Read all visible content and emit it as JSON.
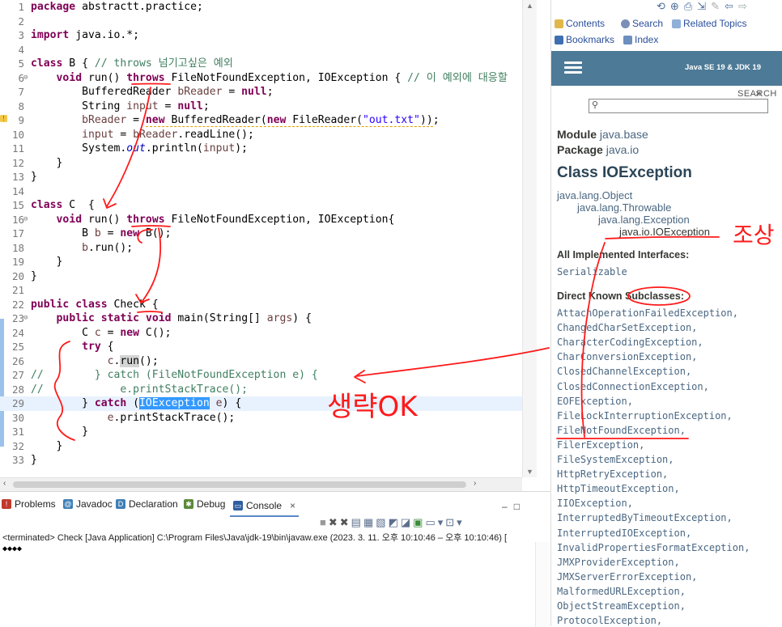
{
  "editor": {
    "lines": [
      {
        "n": "1",
        "marker": "",
        "html": "<span class=\"kw\">package</span> abstractt.practice;"
      },
      {
        "n": "2",
        "marker": "",
        "html": ""
      },
      {
        "n": "3",
        "marker": "",
        "html": "<span class=\"kw\">import</span> java.io.*;"
      },
      {
        "n": "4",
        "marker": "",
        "html": ""
      },
      {
        "n": "5",
        "marker": "",
        "html": "<span class=\"kw\">class</span> B { <span class=\"cm\">// throws 넘기고싶은 예외</span>"
      },
      {
        "n": "6",
        "marker": "⊖",
        "html": "    <span class=\"kw\">void</span> run() <span class=\"kw\">throws</span> FileNotFoundException, IOException { <span class=\"cm\">// 이 예외에 대응할</span>"
      },
      {
        "n": "7",
        "marker": "",
        "html": "        BufferedReader <span class=\"varu\">bReader</span> = <span class=\"kw\">null</span>;"
      },
      {
        "n": "8",
        "marker": "",
        "html": "        String <span class=\"varu\">input</span> = <span class=\"kw\">null</span>;"
      },
      {
        "n": "9",
        "marker": "",
        "html": "        <span class=\"varu\">bReader</span> = <span class=\"uline\"><span class=\"kw\">new</span> BufferedReader(<span class=\"kw\">new</span> FileReader(<span class=\"str\">\"out.txt\"</span>))</span>;"
      },
      {
        "n": "10",
        "marker": "",
        "html": "        <span class=\"varu\">input</span> = <span class=\"varu\">bReader</span>.readLine();"
      },
      {
        "n": "11",
        "marker": "",
        "html": "        System.<span class=\"field\">out</span>.println(<span class=\"varu\">input</span>);"
      },
      {
        "n": "12",
        "marker": "",
        "html": "    }"
      },
      {
        "n": "13",
        "marker": "",
        "html": "}"
      },
      {
        "n": "14",
        "marker": "",
        "html": ""
      },
      {
        "n": "15",
        "marker": "",
        "html": "<span class=\"kw\">class</span> C  {"
      },
      {
        "n": "16",
        "marker": "⊖",
        "html": "    <span class=\"kw\">void</span> run() <span class=\"kw\">throws</span> FileNotFoundException, IOException{"
      },
      {
        "n": "17",
        "marker": "",
        "html": "        B <span class=\"varu\">b</span> = <span class=\"kw\">new</span> B();"
      },
      {
        "n": "18",
        "marker": "",
        "html": "        <span class=\"varu\">b</span>.run();"
      },
      {
        "n": "19",
        "marker": "",
        "html": "    }"
      },
      {
        "n": "20",
        "marker": "",
        "html": "}"
      },
      {
        "n": "21",
        "marker": "",
        "html": ""
      },
      {
        "n": "22",
        "marker": "",
        "html": "<span class=\"kw\">public</span> <span class=\"kw\">class</span> Check {"
      },
      {
        "n": "23",
        "marker": "⊖",
        "html": "    <span class=\"kw\">public</span> <span class=\"kw\">static</span> <span class=\"kw\">void</span> main(String[] <span class=\"varu\">args</span>) {"
      },
      {
        "n": "24",
        "marker": "",
        "html": "        C <span class=\"varu\">c</span> = <span class=\"kw\">new</span> C();"
      },
      {
        "n": "25",
        "marker": "",
        "html": "        <span class=\"kw\">try</span> {"
      },
      {
        "n": "26",
        "marker": "",
        "html": "            <span class=\"varu\">c</span>.<span class=\"occ\">run</span>();"
      },
      {
        "n": "27",
        "marker": "",
        "html": "<span class=\"cm\">//        } catch (FileNotFoundException e) {</span>"
      },
      {
        "n": "28",
        "marker": "",
        "html": "<span class=\"cm\">//            e.printStackTrace();</span>"
      },
      {
        "n": "29",
        "marker": "",
        "html": "        } <span class=\"kw\">catch</span> (<span class=\"sel\">IOException</span> <span class=\"varu\">e</span>) {",
        "highlight": true
      },
      {
        "n": "30",
        "marker": "",
        "html": "            <span class=\"varu\">e</span>.printStackTrace();"
      },
      {
        "n": "31",
        "marker": "",
        "html": "        }"
      },
      {
        "n": "32",
        "marker": "",
        "html": "    }"
      },
      {
        "n": "33",
        "marker": "",
        "html": "}"
      }
    ]
  },
  "panel": {
    "tabs": [
      {
        "id": "problems",
        "label": "Problems",
        "icon": "problems-icon",
        "color": "#c0392b"
      },
      {
        "id": "javadoc",
        "label": "Javadoc",
        "icon": "javadoc-icon",
        "color": "#3f7fb5"
      },
      {
        "id": "declaration",
        "label": "Declaration",
        "icon": "declaration-icon",
        "color": "#3f7fb5"
      },
      {
        "id": "debug",
        "label": "Debug",
        "icon": "debug-icon",
        "color": "#5a8a3a"
      },
      {
        "id": "console",
        "label": "Console",
        "icon": "console-icon",
        "color": "#2f5fa0"
      }
    ],
    "console_close": "×",
    "status": "<terminated> Check [Java Application] C:\\Program Files\\Java\\jdk-19\\bin\\javaw.exe  (2023. 3. 11. 오후 10:10:46 – 오후 10:10:46) [",
    "output": "◆◆◆◆"
  },
  "help": {
    "contents": "Contents",
    "search": "Search",
    "related": "Related Topics",
    "bookmarks": "Bookmarks",
    "index": "Index",
    "banner_title": "Java SE 19 & JDK 19",
    "search_label": "SEARCH",
    "module_label": "Module",
    "module_value": "java.base",
    "package_label": "Package",
    "package_value": "java.io",
    "class_title": "Class IOException",
    "hierarchy": [
      "java.lang.Object",
      "java.lang.Throwable",
      "java.lang.Exception",
      "java.io.IOException"
    ],
    "implemented_heading": "All Implemented Interfaces:",
    "implemented_value": "Serializable",
    "subclasses_heading": "Direct Known Subclasses:",
    "subclasses": [
      "AttachOperationFailedException,",
      "ChangedCharSetException,",
      "CharacterCodingException,",
      "CharConversionException,",
      "ClosedChannelException,",
      "ClosedConnectionException,",
      "EOFException,",
      "FileLockInterruptionException,",
      "FileNotFoundException,",
      "FilerException,",
      "FileSystemException,",
      "HttpRetryException,",
      "HttpTimeoutException,",
      "IIOException,",
      "InterruptedByTimeoutException,",
      "InterruptedIOException,",
      "InvalidPropertiesFormatException,",
      "JMXProviderException,",
      "JMXServerErrorException,",
      "MalformedURLException,",
      "ObjectStreamException,",
      "ProtocolException,"
    ]
  },
  "annotations": {
    "ancestor_note": "조상",
    "omit_ok_note": "생략OK"
  },
  "colors": {
    "annotation_red": "#ff1a1a",
    "banner": "#4d7a97",
    "keyword": "#7f0055",
    "comment": "#3f7f5f",
    "selection": "#3399ff"
  }
}
